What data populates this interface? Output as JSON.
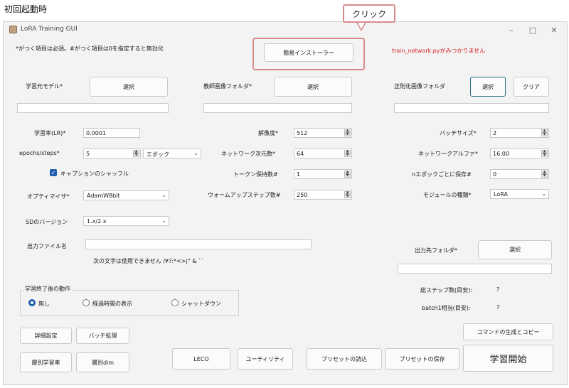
{
  "heading": "初回起動時",
  "window": {
    "title": "LoRA Training GUI",
    "minimize": "–",
    "maximize": "□",
    "close": "✕"
  },
  "note": "*がつく項目は必須。#がつく項目は0を指定すると無効化",
  "installer_button": "簡易インストーラー",
  "warning": "train_network.pyがみつかりません",
  "callout": "クリック",
  "sections": {
    "base_model": {
      "label": "学習元モデル*",
      "button": "選択",
      "path": ""
    },
    "teacher_folder": {
      "label": "教師画像フォルダ*",
      "button": "選択",
      "path": ""
    },
    "reg_folder": {
      "label": "正則化画像フォルダ",
      "button": "選択",
      "clear": "クリア",
      "path": ""
    }
  },
  "left": {
    "lr_label": "学習率(LR)*",
    "lr_value": "0.0001",
    "epochs_label": "epochs/steps*",
    "epochs_value": "5",
    "epochs_unit": "エポック",
    "shuffle_label": "キャプションのシャッフル",
    "optimizer_label": "オプティマイザ*",
    "optimizer_value": "AdamW8bit",
    "sd_label": "SDのバージョン",
    "sd_value": "1.x/2.x"
  },
  "middle": {
    "res_label": "解像度*",
    "res_value": "512",
    "dim_label": "ネットワーク次元数*",
    "dim_value": "64",
    "token_label": "トークン保持数#",
    "token_value": "1",
    "warmup_label": "ウォームアップステップ数#",
    "warmup_value": "250"
  },
  "right": {
    "batch_label": "バッチサイズ*",
    "batch_value": "2",
    "alpha_label": "ネットワークアルファ*",
    "alpha_value": "16.00",
    "save_label": "nエポックごとに保存#",
    "save_value": "0",
    "module_label": "モジュールの種類*",
    "module_value": "LoRA"
  },
  "output": {
    "name_label": "出力ファイル名",
    "name_value": "",
    "hint": "次の文字は使用できません /¥?:*<>|\" & ``",
    "folder_label": "出力先フォルダ*",
    "folder_button": "選択",
    "folder_path": ""
  },
  "after": {
    "title": "学習終了後の動作",
    "options": [
      "無し",
      "経過時間の表示",
      "シャットダウン"
    ]
  },
  "estimates": {
    "steps_label": "総ステップ数(目安):",
    "steps_value": "?",
    "batch_label": "batch1相当(目安):",
    "batch_value": "?"
  },
  "buttons": {
    "detail": "詳細設定",
    "batch": "バッチ処理",
    "layer_lr": "層別学習率",
    "layer_dim": "層別dim",
    "leco": "LECO",
    "utility": "ユーティリティ",
    "load_preset": "プリセットの読込",
    "save_preset": "プリセットの保存",
    "generate": "コマンドの生成とコピー",
    "start": "学習開始"
  }
}
